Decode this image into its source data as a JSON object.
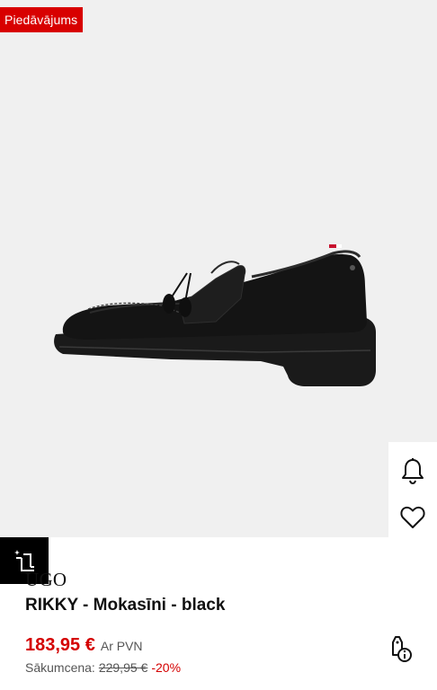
{
  "badge": {
    "label": "Piedāvājums",
    "color": "#d80000"
  },
  "product": {
    "brand": "HUGO",
    "brand_visible": "UGO",
    "title": "RIKKY - Mokasīni - black",
    "price": "183,95 €",
    "vat_label": "Ar PVN",
    "original_label": "Sākumcena:",
    "original_price": "229,95 €",
    "discount": "-20%"
  },
  "icons": {
    "bell": "bell-icon",
    "heart": "heart-icon",
    "similar": "find-similar-icon",
    "price_tag": "price-tag-info-icon"
  },
  "colors": {
    "accent_red": "#d40000",
    "image_bg": "#f0f0f0"
  }
}
